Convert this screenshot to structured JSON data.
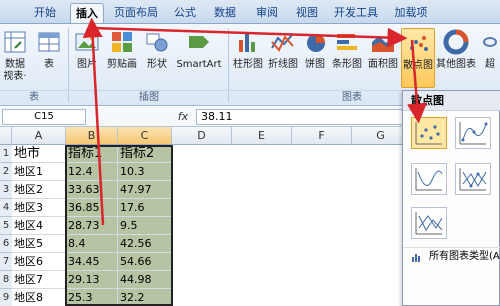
{
  "tabs": [
    "开始",
    "插入",
    "页面布局",
    "公式",
    "数据",
    "审阅",
    "视图",
    "开发工具",
    "加载项"
  ],
  "ribbon": {
    "buttons": {
      "pivot": "数据",
      "pivot2": "视表·",
      "table": "表",
      "picture": "图片",
      "clipart": "剪贴画",
      "shapes": "形状",
      "smartart": "SmartArt",
      "column": "柱形图",
      "line": "折线图",
      "pie": "饼图",
      "bar": "条形图",
      "area": "面积图",
      "scatter": "散点图",
      "other": "其他图表",
      "super": "超"
    },
    "groups": {
      "tables": "表",
      "illustrations": "插图",
      "charts": "图表"
    }
  },
  "formula_bar": {
    "cell_ref": "C15",
    "fx": "fx",
    "value": "38.11"
  },
  "columns": [
    "A",
    "B",
    "C",
    "D",
    "E",
    "F",
    "G"
  ],
  "rows": [
    {
      "n": "1",
      "a": "地市",
      "b": "指标1",
      "c": "指标2"
    },
    {
      "n": "2",
      "a": "地区1",
      "b": "12.4",
      "c": "10.3"
    },
    {
      "n": "3",
      "a": "地区2",
      "b": "33.63",
      "c": "47.97"
    },
    {
      "n": "4",
      "a": "地区3",
      "b": "36.85",
      "c": "17.6"
    },
    {
      "n": "5",
      "a": "地区4",
      "b": "28.73",
      "c": "9.5"
    },
    {
      "n": "6",
      "a": "地区5",
      "b": "8.4",
      "c": "42.56"
    },
    {
      "n": "7",
      "a": "地区6",
      "b": "34.45",
      "c": "54.66"
    },
    {
      "n": "8",
      "a": "地区7",
      "b": "29.13",
      "c": "44.98"
    },
    {
      "n": "9",
      "a": "地区8",
      "b": "25.3",
      "c": "32.2"
    }
  ],
  "dropdown": {
    "title": "散点图",
    "footer": "所有图表类型(A..."
  },
  "colors": {
    "accent_arrow": "#d9262c",
    "selection": "#b6c4a4",
    "highlight": "#ffe7a4"
  }
}
